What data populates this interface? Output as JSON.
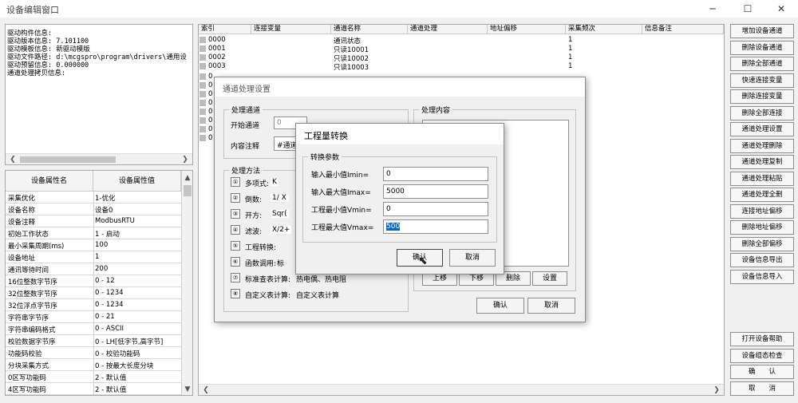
{
  "window": {
    "title": "设备编辑窗口",
    "min": "─",
    "max": "☐",
    "close": "✕"
  },
  "driver_info": [
    "驱动构件信息:",
    "驱动版本信息: 7.101100",
    "驱动模板信息: 新驱动模版",
    "驱动文件路径: d:\\mcgspro\\program\\drivers\\通用设",
    "驱动预留信息: 0.000000",
    "通道处理拷贝信息:"
  ],
  "prop_table": {
    "headers": [
      "设备属性名",
      "设备属性值"
    ],
    "rows": [
      [
        "采集优化",
        "1-优化"
      ],
      [
        "设备名称",
        "设备0"
      ],
      [
        "设备注释",
        "ModbusRTU"
      ],
      [
        "初始工作状态",
        "1 - 启动"
      ],
      [
        "最小采集周期(ms)",
        "100"
      ],
      [
        "设备地址",
        "1"
      ],
      [
        "通讯等待时间",
        "200"
      ],
      [
        "16位整数字节序",
        "0 - 12"
      ],
      [
        "32位整数字节序",
        "0 - 1234"
      ],
      [
        "32位浮点字节序",
        "0 - 1234"
      ],
      [
        "字符串字节序",
        "0 - 21"
      ],
      [
        "字符串编码格式",
        "0 - ASCII"
      ],
      [
        "校验数据字节序",
        "0 - LH[低字节,高字节]"
      ],
      [
        "功能码校验",
        "0 - 校验功能码"
      ],
      [
        "分块采集方式",
        "0 - 按最大长度分块"
      ],
      [
        "0区写功能码",
        "2 - 默认值"
      ],
      [
        "4区写功能码",
        "2 - 默认值"
      ]
    ]
  },
  "channel_table": {
    "headers": [
      "索引",
      "连接变量",
      "通道名称",
      "通道处理",
      "地址偏移",
      "采集频次",
      "信息备注"
    ],
    "rows": [
      [
        "0000",
        "",
        "通讯状态",
        "",
        "",
        "1",
        ""
      ],
      [
        "0001",
        "",
        "只读10001",
        "",
        "",
        "1",
        ""
      ],
      [
        "0002",
        "",
        "只读10002",
        "",
        "",
        "1",
        ""
      ],
      [
        "0003",
        "",
        "只读10003",
        "",
        "",
        "1",
        ""
      ]
    ],
    "hidden_index_prefix": [
      "0",
      "0",
      "0",
      "0",
      "0",
      "0",
      "0",
      "0"
    ]
  },
  "right_buttons": [
    "增加设备通道",
    "删除设备通道",
    "删除全部通道",
    "快速连接变量",
    "删除连接变量",
    "删除全部连接",
    "通道处理设置",
    "通道处理删除",
    "通道处理复制",
    "通道处理粘贴",
    "通道处理全删",
    "连接地址偏移",
    "删除地址偏移",
    "删除全部偏移",
    "设备信息导出",
    "设备信息导入"
  ],
  "right_buttons_bottom": [
    "打开设备帮助",
    "设备组态检查",
    "确　　认",
    "取　　消"
  ],
  "process_dialog": {
    "title": "通道处理设置",
    "group_channel": "处理通道",
    "start_channel_label": "开始通道",
    "start_channel_value": "0",
    "note_label": "内容注释",
    "note_value": "#通道",
    "group_content": "处理内容",
    "group_method": "处理方法",
    "methods": [
      {
        "num": "①",
        "label": "多项式:",
        "extra": "K"
      },
      {
        "num": "②",
        "label": "倒数:",
        "extra": "1/ X"
      },
      {
        "num": "③",
        "label": "开方:",
        "extra": "Sqr("
      },
      {
        "num": "④",
        "label": "滤波:",
        "extra": "X/2+"
      },
      {
        "num": "⑤",
        "label": "工程转换:",
        "extra": ""
      },
      {
        "num": "⑥",
        "label": "函数调用:",
        "extra": "标"
      },
      {
        "num": "⑦",
        "label": "标准查表计算:",
        "extra": "热电偶、热电阻"
      },
      {
        "num": "⑧",
        "label": "自定义表计算:",
        "extra": "自定义表计算"
      }
    ],
    "list_buttons": [
      "上移",
      "下移",
      "删除",
      "设置"
    ],
    "ok": "确认",
    "cancel": "取消"
  },
  "conv_dialog": {
    "title": "工程量转换",
    "group": "转换参数",
    "fields": [
      {
        "label": "输入最小值Imin=",
        "value": "0"
      },
      {
        "label": "输入最大值Imax=",
        "value": "5000"
      },
      {
        "label": "工程最小值Vmin=",
        "value": "0"
      },
      {
        "label": "工程最大值Vmax=",
        "value": "500"
      }
    ],
    "ok": "确认",
    "cancel": "取消"
  }
}
